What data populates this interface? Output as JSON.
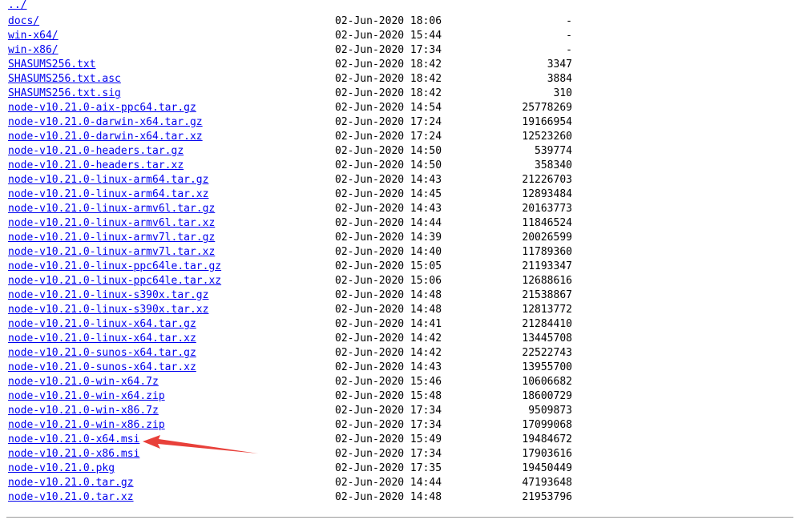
{
  "parent": {
    "label": "../"
  },
  "entries": [
    {
      "name": "docs/",
      "date": "02-Jun-2020 18:06",
      "size": "-"
    },
    {
      "name": "win-x64/",
      "date": "02-Jun-2020 15:44",
      "size": "-"
    },
    {
      "name": "win-x86/",
      "date": "02-Jun-2020 17:34",
      "size": "-"
    },
    {
      "name": "SHASUMS256.txt",
      "date": "02-Jun-2020 18:42",
      "size": "3347"
    },
    {
      "name": "SHASUMS256.txt.asc",
      "date": "02-Jun-2020 18:42",
      "size": "3884"
    },
    {
      "name": "SHASUMS256.txt.sig",
      "date": "02-Jun-2020 18:42",
      "size": "310"
    },
    {
      "name": "node-v10.21.0-aix-ppc64.tar.gz",
      "date": "02-Jun-2020 14:54",
      "size": "25778269"
    },
    {
      "name": "node-v10.21.0-darwin-x64.tar.gz",
      "date": "02-Jun-2020 17:24",
      "size": "19166954"
    },
    {
      "name": "node-v10.21.0-darwin-x64.tar.xz",
      "date": "02-Jun-2020 17:24",
      "size": "12523260"
    },
    {
      "name": "node-v10.21.0-headers.tar.gz",
      "date": "02-Jun-2020 14:50",
      "size": "539774"
    },
    {
      "name": "node-v10.21.0-headers.tar.xz",
      "date": "02-Jun-2020 14:50",
      "size": "358340"
    },
    {
      "name": "node-v10.21.0-linux-arm64.tar.gz",
      "date": "02-Jun-2020 14:43",
      "size": "21226703"
    },
    {
      "name": "node-v10.21.0-linux-arm64.tar.xz",
      "date": "02-Jun-2020 14:45",
      "size": "12893484"
    },
    {
      "name": "node-v10.21.0-linux-armv6l.tar.gz",
      "date": "02-Jun-2020 14:43",
      "size": "20163773"
    },
    {
      "name": "node-v10.21.0-linux-armv6l.tar.xz",
      "date": "02-Jun-2020 14:44",
      "size": "11846524"
    },
    {
      "name": "node-v10.21.0-linux-armv7l.tar.gz",
      "date": "02-Jun-2020 14:39",
      "size": "20026599"
    },
    {
      "name": "node-v10.21.0-linux-armv7l.tar.xz",
      "date": "02-Jun-2020 14:40",
      "size": "11789360"
    },
    {
      "name": "node-v10.21.0-linux-ppc64le.tar.gz",
      "date": "02-Jun-2020 15:05",
      "size": "21193347"
    },
    {
      "name": "node-v10.21.0-linux-ppc64le.tar.xz",
      "date": "02-Jun-2020 15:06",
      "size": "12688616"
    },
    {
      "name": "node-v10.21.0-linux-s390x.tar.gz",
      "date": "02-Jun-2020 14:48",
      "size": "21538867"
    },
    {
      "name": "node-v10.21.0-linux-s390x.tar.xz",
      "date": "02-Jun-2020 14:48",
      "size": "12813772"
    },
    {
      "name": "node-v10.21.0-linux-x64.tar.gz",
      "date": "02-Jun-2020 14:41",
      "size": "21284410"
    },
    {
      "name": "node-v10.21.0-linux-x64.tar.xz",
      "date": "02-Jun-2020 14:42",
      "size": "13445708"
    },
    {
      "name": "node-v10.21.0-sunos-x64.tar.gz",
      "date": "02-Jun-2020 14:42",
      "size": "22522743"
    },
    {
      "name": "node-v10.21.0-sunos-x64.tar.xz",
      "date": "02-Jun-2020 14:43",
      "size": "13955700"
    },
    {
      "name": "node-v10.21.0-win-x64.7z",
      "date": "02-Jun-2020 15:46",
      "size": "10606682"
    },
    {
      "name": "node-v10.21.0-win-x64.zip",
      "date": "02-Jun-2020 15:48",
      "size": "18600729"
    },
    {
      "name": "node-v10.21.0-win-x86.7z",
      "date": "02-Jun-2020 17:34",
      "size": "9509873"
    },
    {
      "name": "node-v10.21.0-win-x86.zip",
      "date": "02-Jun-2020 17:34",
      "size": "17099068"
    },
    {
      "name": "node-v10.21.0-x64.msi",
      "date": "02-Jun-2020 15:49",
      "size": "19484672"
    },
    {
      "name": "node-v10.21.0-x86.msi",
      "date": "02-Jun-2020 17:34",
      "size": "17903616"
    },
    {
      "name": "node-v10.21.0.pkg",
      "date": "02-Jun-2020 17:35",
      "size": "19450449"
    },
    {
      "name": "node-v10.21.0.tar.gz",
      "date": "02-Jun-2020 14:44",
      "size": "47193648"
    },
    {
      "name": "node-v10.21.0.tar.xz",
      "date": "02-Jun-2020 14:48",
      "size": "21953796"
    }
  ],
  "annotation": {
    "target": "node-v10.21.0-x64.msi",
    "color": "#e8403a"
  },
  "colors": {
    "link": "#0000ee",
    "text": "#000000",
    "rule": "#9a9a9a"
  }
}
